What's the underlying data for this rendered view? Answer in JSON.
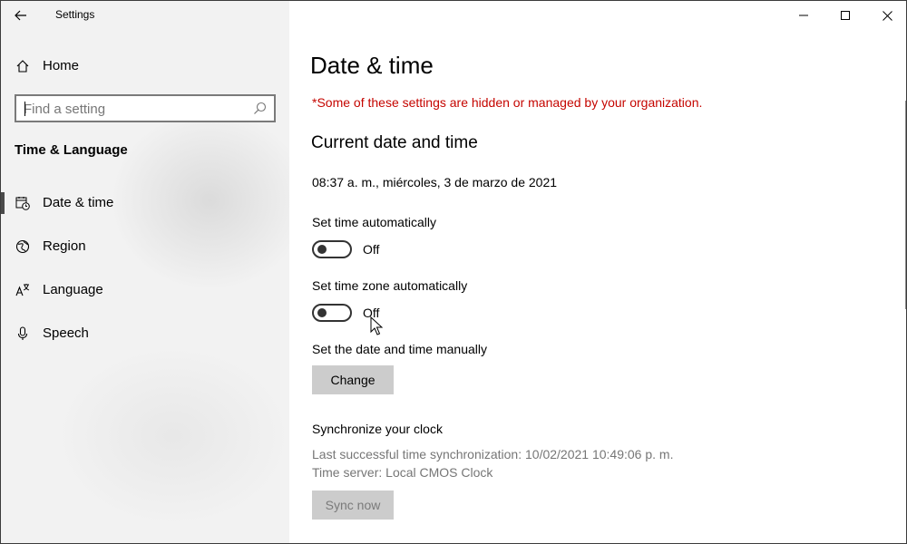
{
  "window": {
    "title": "Settings"
  },
  "sidebar": {
    "home_label": "Home",
    "search_placeholder": "Find a setting",
    "section_title": "Time & Language",
    "items": [
      {
        "label": "Date & time",
        "icon": "calendar-clock-icon",
        "selected": true
      },
      {
        "label": "Region",
        "icon": "globe-icon",
        "selected": false
      },
      {
        "label": "Language",
        "icon": "language-icon",
        "selected": false
      },
      {
        "label": "Speech",
        "icon": "microphone-icon",
        "selected": false
      }
    ]
  },
  "main": {
    "page_title": "Date & time",
    "managed_note": "*Some of these settings are hidden or managed by your organization.",
    "current_heading": "Current date and time",
    "current_datetime": "08:37 a. m., miércoles, 3 de marzo de 2021",
    "set_time_auto": {
      "label": "Set time automatically",
      "state": "Off"
    },
    "set_timezone_auto": {
      "label": "Set time zone automatically",
      "state": "Off"
    },
    "manual_label": "Set the date and time manually",
    "change_button": "Change",
    "sync_heading": "Synchronize your clock",
    "last_sync": "Last successful time synchronization: 10/02/2021 10:49:06 p. m.",
    "time_server": "Time server: Local CMOS Clock",
    "sync_button": "Sync now"
  },
  "colors": {
    "accent_warning": "#c50500",
    "sidebar_bg": "#f2f2f2",
    "button_bg": "#cccccc"
  }
}
